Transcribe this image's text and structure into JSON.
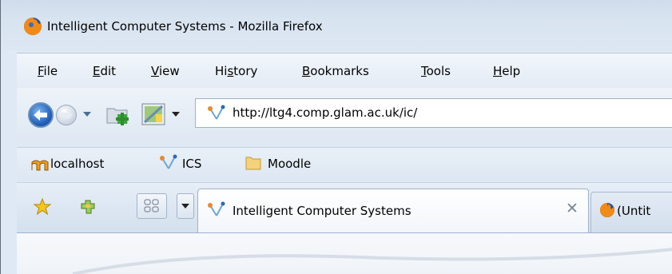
{
  "window": {
    "title": "Intelligent Computer Systems - Mozilla Firefox"
  },
  "menu": {
    "items": [
      {
        "label": "File",
        "key": "F",
        "rest": "ile"
      },
      {
        "label": "Edit",
        "key": "E",
        "rest": "dit"
      },
      {
        "label": "View",
        "key": "V",
        "rest": "iew"
      },
      {
        "label": "History",
        "pre": "Hi",
        "key": "s",
        "rest": "tory"
      },
      {
        "label": "Bookmarks",
        "key": "B",
        "rest": "ookmarks"
      },
      {
        "label": "Tools",
        "key": "T",
        "rest": "ools"
      },
      {
        "label": "Help",
        "key": "H",
        "rest": "elp"
      }
    ]
  },
  "navbar": {
    "url": "http://ltg4.comp.glam.ac.uk/ic/"
  },
  "bookmarks": [
    {
      "label": "localhost",
      "icon": "moodle-logo-icon"
    },
    {
      "label": "ICS",
      "icon": "site-favicon-icon"
    },
    {
      "label": "Moodle",
      "icon": "folder-icon"
    }
  ],
  "tabs": [
    {
      "label": "Intelligent Computer Systems",
      "active": true,
      "close": "✕"
    },
    {
      "label": "(Untit",
      "active": false
    }
  ],
  "colors": {
    "accent": "#1e5fb8",
    "bar": "#dfe8f3"
  }
}
